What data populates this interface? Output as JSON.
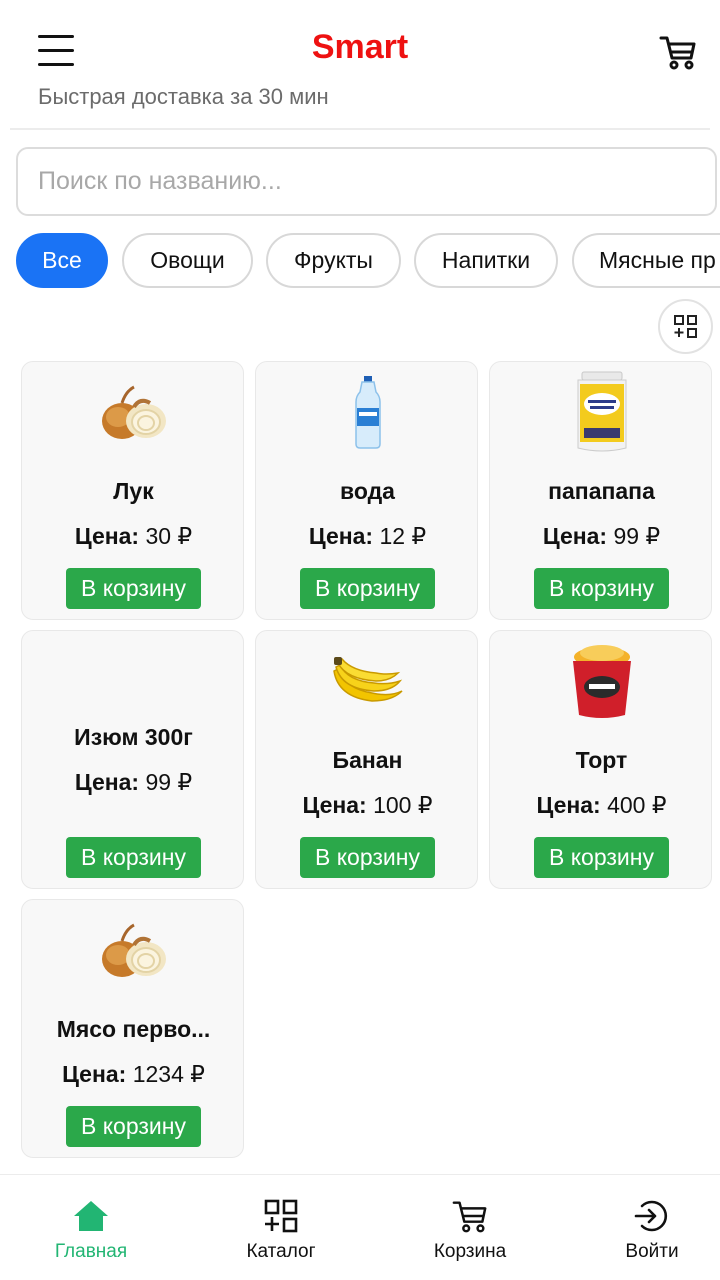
{
  "header": {
    "brand": "Smart",
    "tagline": "Быстрая доставка за 30 мин"
  },
  "search": {
    "placeholder": "Поиск по названию...",
    "value": ""
  },
  "categories": [
    {
      "label": "Все",
      "active": true
    },
    {
      "label": "Овощи",
      "active": false
    },
    {
      "label": "Фрукты",
      "active": false
    },
    {
      "label": "Напитки",
      "active": false
    },
    {
      "label": "Мясные пр",
      "active": false
    }
  ],
  "price_label": "Цена:",
  "currency": "₽",
  "products": [
    {
      "name": "Лук",
      "price": "30",
      "button": "В корзину",
      "image_icon": "onion-icon"
    },
    {
      "name": "вода",
      "price": "12",
      "button": "В корзину",
      "image_icon": "water-bottle-icon"
    },
    {
      "name": "папапапа",
      "price": "99",
      "button": "В корзину",
      "image_icon": "flour-bag-icon"
    },
    {
      "name": "Изюм 300г",
      "price": "99",
      "button": "В корзину",
      "image_icon": ""
    },
    {
      "name": "Банан",
      "price": "100",
      "button": "В корзину",
      "image_icon": "banana-icon"
    },
    {
      "name": "Торт",
      "price": "400",
      "button": "В корзину",
      "image_icon": "yogurt-cup-icon"
    },
    {
      "name": "Мясо перво...",
      "price": "1234",
      "button": "В корзину",
      "image_icon": "onion-icon"
    }
  ],
  "nav": [
    {
      "label": "Главная",
      "icon": "home-icon",
      "active": true
    },
    {
      "label": "Каталог",
      "icon": "catalog-icon",
      "active": false
    },
    {
      "label": "Корзина",
      "icon": "cart-icon",
      "active": false
    },
    {
      "label": "Войти",
      "icon": "login-icon",
      "active": false
    }
  ],
  "colors": {
    "brand": "#ee1111",
    "chip_active": "#1a73f5",
    "cart_button": "#2ba84a",
    "nav_active": "#22b573"
  }
}
